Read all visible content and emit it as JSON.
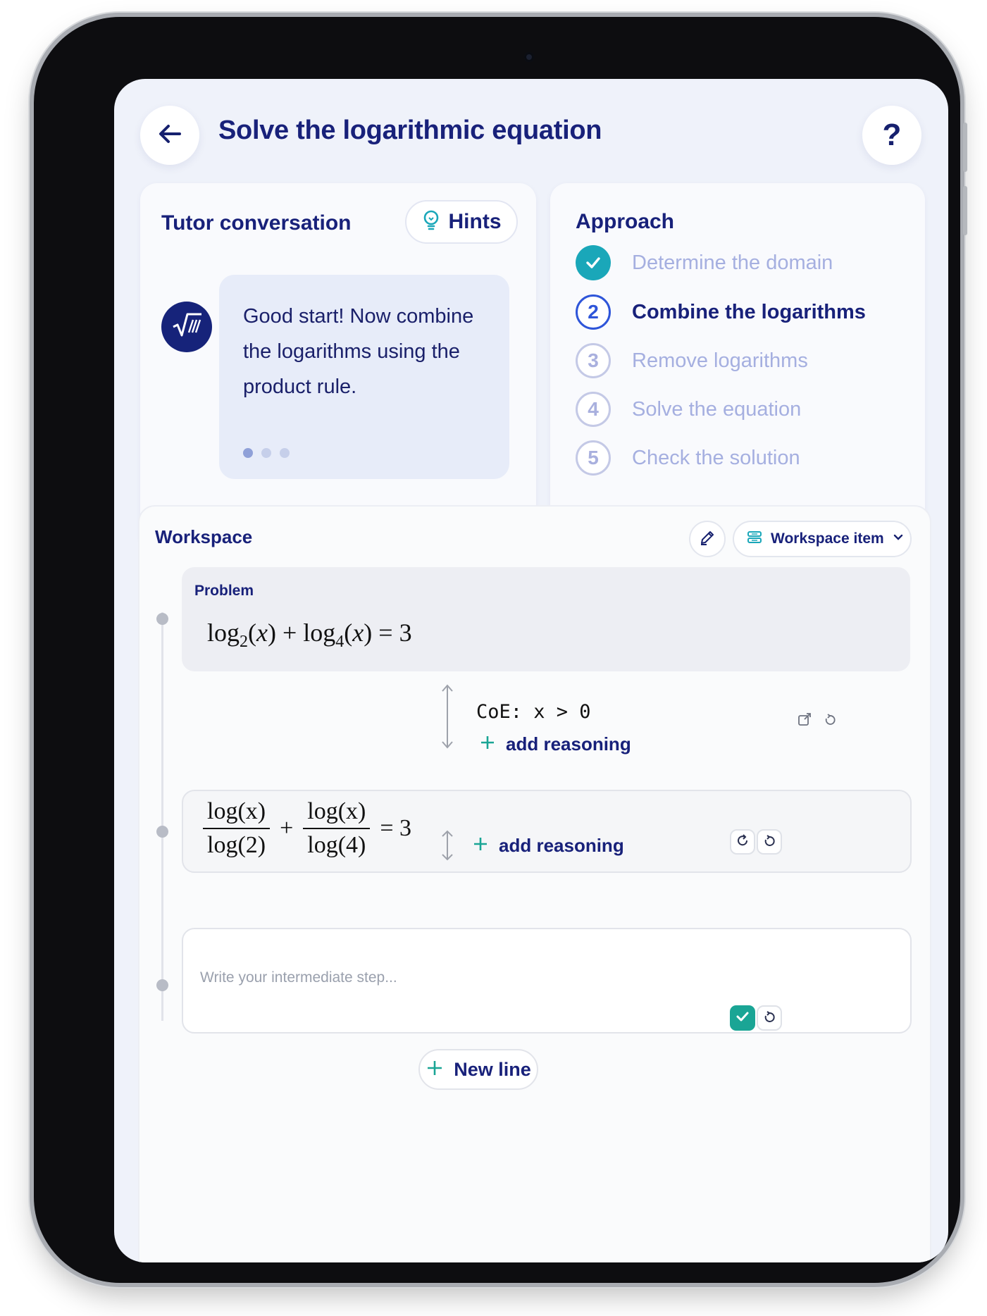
{
  "header": {
    "title": "Solve the logarithmic equation",
    "help_label": "?"
  },
  "tutor": {
    "title": "Tutor conversation",
    "hints_label": "Hints",
    "message": "Good start! Now combine the logarithms using the product rule.",
    "pager": {
      "total": 3,
      "active": 1
    }
  },
  "approach": {
    "title": "Approach",
    "steps": [
      {
        "num": "",
        "label": "Determine the domain",
        "state": "done"
      },
      {
        "num": "2",
        "label": "Combine the logarithms",
        "state": "current"
      },
      {
        "num": "3",
        "label": "Remove logarithms",
        "state": "todo"
      },
      {
        "num": "4",
        "label": "Solve the equation",
        "state": "todo"
      },
      {
        "num": "5",
        "label": "Check the solution",
        "state": "todo"
      }
    ]
  },
  "workspace": {
    "title": "Workspace",
    "item_select_label": "Workspace item",
    "problem_label": "Problem",
    "problem_equation": "log2(x) + log4(x) = 3",
    "condition": "CoE: x > 0",
    "add_reasoning_label": "add reasoning",
    "step1": {
      "left_num": "log(x)",
      "left_den": "log(2)",
      "plus": "+",
      "right_num": "log(x)",
      "right_den": "log(4)",
      "rhs": "= 3"
    },
    "input_placeholder": "Write your intermediate step...",
    "new_line_label": "New line"
  },
  "colors": {
    "primary_text": "#18217a",
    "accent_teal": "#1aa7b9",
    "current_step_blue": "#2e55d9",
    "confirm_green": "#1aa595"
  }
}
